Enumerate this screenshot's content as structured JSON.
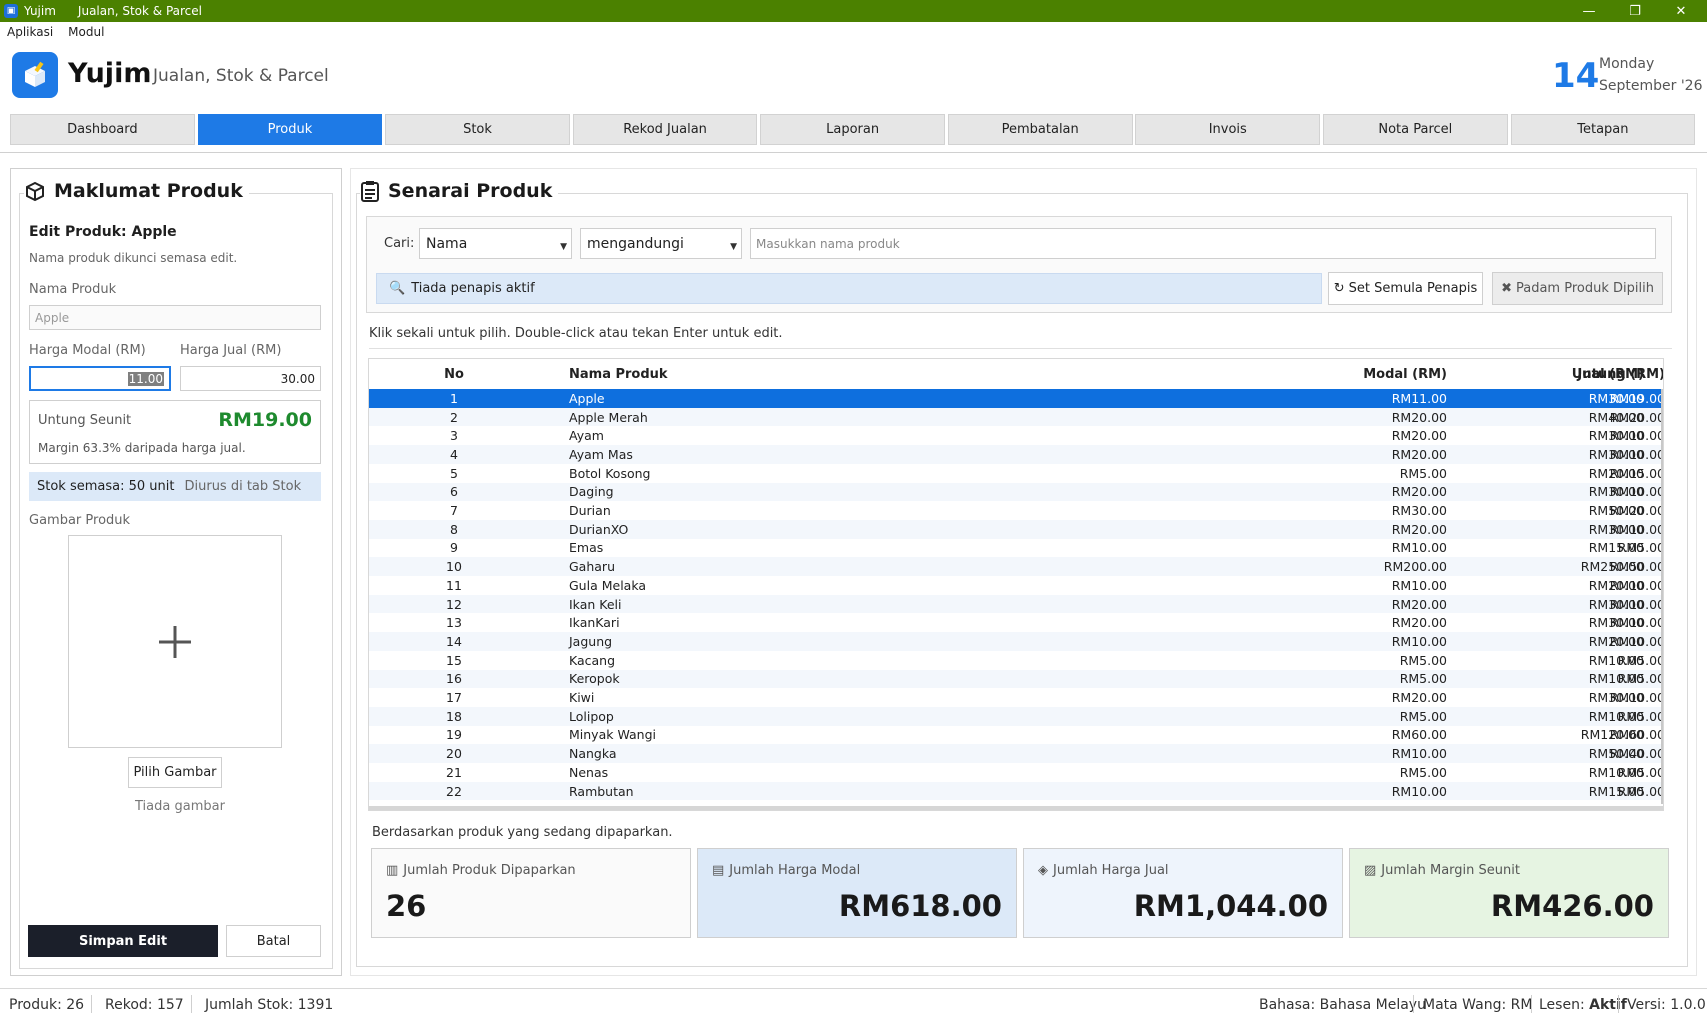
{
  "window": {
    "app_name": "Yujim",
    "title": "Jualan, Stok & Parcel",
    "controls": [
      "minimize-icon",
      "restore-icon",
      "close-icon"
    ]
  },
  "menubar": [
    "Aplikasi",
    "Modul"
  ],
  "header": {
    "brand": "Yujim",
    "subtitle": "Jualan, Stok & Parcel",
    "day": "14",
    "weekday": "Monday",
    "month_year": "September '26"
  },
  "tabs": [
    "Dashboard",
    "Produk",
    "Stok",
    "Rekod Jualan",
    "Laporan",
    "Pembatalan",
    "Invois",
    "Nota Parcel",
    "Tetapan"
  ],
  "active_tab": "Produk",
  "colors": {
    "accent": "#1e7ae6",
    "titlebar": "#4b8100",
    "profit": "#1e8a2e",
    "selection": "#0e6fde"
  },
  "left": {
    "title": "Maklumat Produk",
    "edit_heading": "Edit Produk: Apple",
    "locked_note": "Nama produk dikunci semasa edit.",
    "name_label": "Nama Produk",
    "name_value": "Apple",
    "cost_label": "Harga Modal (RM)",
    "cost_value": "11.00",
    "sell_label": "Harga Jual (RM)",
    "sell_value": "30.00",
    "profit_label": "Untung Seunit",
    "profit_value": "RM19.00",
    "margin_text": "Margin 63.3% daripada harga jual.",
    "stock_text": "Stok semasa: 50 unit",
    "stock_note": "Diurus di tab Stok",
    "image_label": "Gambar Produk",
    "pick_image": "Pilih Gambar",
    "no_image": "Tiada gambar",
    "save_button": "Simpan Edit",
    "cancel_button": "Batal"
  },
  "right": {
    "title": "Senarai Produk",
    "search_label": "Cari:",
    "field_select": "Nama",
    "match_select": "mengandungi",
    "search_placeholder": "Masukkan nama produk",
    "filter_status": "Tiada penapis aktif",
    "reset_button": "Set Semula Penapis",
    "delete_button": "Padam Produk Dipilih",
    "hint": "Klik sekali untuk pilih. Double-click atau tekan Enter untuk edit.",
    "columns": [
      "No",
      "Nama Produk",
      "Modal (RM)",
      "Jual (RM)",
      "Untung (RM)"
    ],
    "selected_row": 0,
    "rows": [
      [
        "1",
        "Apple",
        "RM11.00",
        "RM30.00",
        "RM19.00"
      ],
      [
        "2",
        "Apple Merah",
        "RM20.00",
        "RM40.00",
        "RM20.00"
      ],
      [
        "3",
        "Ayam",
        "RM20.00",
        "RM30.00",
        "RM10.00"
      ],
      [
        "4",
        "Ayam Mas",
        "RM20.00",
        "RM30.00",
        "RM10.00"
      ],
      [
        "5",
        "Botol Kosong",
        "RM5.00",
        "RM20.00",
        "RM15.00"
      ],
      [
        "6",
        "Daging",
        "RM20.00",
        "RM30.00",
        "RM10.00"
      ],
      [
        "7",
        "Durian",
        "RM30.00",
        "RM50.00",
        "RM20.00"
      ],
      [
        "8",
        "DurianXO",
        "RM20.00",
        "RM30.00",
        "RM10.00"
      ],
      [
        "9",
        "Emas",
        "RM10.00",
        "RM15.00",
        "RM5.00"
      ],
      [
        "10",
        "Gaharu",
        "RM200.00",
        "RM250.00",
        "RM50.00"
      ],
      [
        "11",
        "Gula Melaka",
        "RM10.00",
        "RM20.00",
        "RM10.00"
      ],
      [
        "12",
        "Ikan Keli",
        "RM20.00",
        "RM30.00",
        "RM10.00"
      ],
      [
        "13",
        "IkanKari",
        "RM20.00",
        "RM30.00",
        "RM10.00"
      ],
      [
        "14",
        "Jagung",
        "RM10.00",
        "RM20.00",
        "RM10.00"
      ],
      [
        "15",
        "Kacang",
        "RM5.00",
        "RM10.00",
        "RM5.00"
      ],
      [
        "16",
        "Keropok",
        "RM5.00",
        "RM10.00",
        "RM5.00"
      ],
      [
        "17",
        "Kiwi",
        "RM20.00",
        "RM30.00",
        "RM10.00"
      ],
      [
        "18",
        "Lolipop",
        "RM5.00",
        "RM10.00",
        "RM5.00"
      ],
      [
        "19",
        "Minyak Wangi",
        "RM60.00",
        "RM120.00",
        "RM60.00"
      ],
      [
        "20",
        "Nangka",
        "RM10.00",
        "RM50.00",
        "RM40.00"
      ],
      [
        "21",
        "Nenas",
        "RM5.00",
        "RM10.00",
        "RM5.00"
      ],
      [
        "22",
        "Rambutan",
        "RM10.00",
        "RM15.00",
        "RM5.00"
      ]
    ],
    "summary_note": "Berdasarkan produk yang sedang dipaparkan.",
    "cards": [
      {
        "title": "Jumlah Produk Dipaparkan",
        "value": "26",
        "icon": "bar-chart-icon"
      },
      {
        "title": "Jumlah Harga Modal",
        "value": "RM618.00",
        "icon": "wallet-icon"
      },
      {
        "title": "Jumlah Harga Jual",
        "value": "RM1,044.00",
        "icon": "tag-icon"
      },
      {
        "title": "Jumlah Margin Seunit",
        "value": "RM426.00",
        "icon": "chart-icon"
      }
    ]
  },
  "statusbar": {
    "produk": "Produk: 26",
    "rekod": "Rekod: 157",
    "stok": "Jumlah Stok: 1391",
    "bahasa": "Bahasa: Bahasa Melayu",
    "mata_wang": "Mata Wang: RM",
    "lesen_label": "Lesen:",
    "lesen_value": "Aktif",
    "versi": "Versi: 1.0.0"
  }
}
